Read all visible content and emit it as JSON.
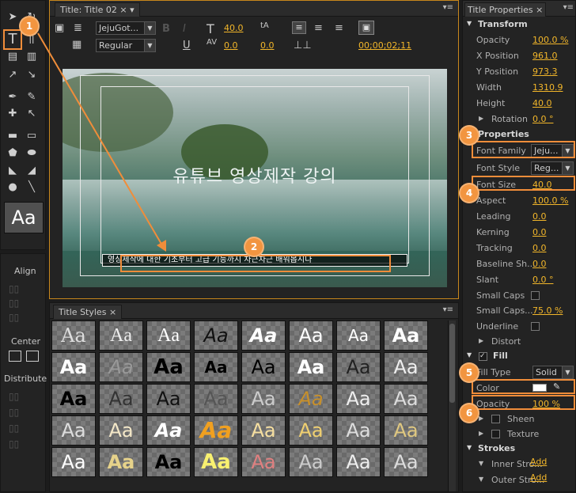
{
  "tools": {
    "aa_preview": "Aa",
    "align_label": "Align",
    "center_label": "Center",
    "distribute_label": "Distribute"
  },
  "title_panel": {
    "tab_label": "Title: Title 02",
    "font_family": "JejuGot...",
    "font_style": "Regular",
    "font_size": "40.0",
    "kerning": "0.0",
    "leading": "0.0",
    "timecode": "00;00;02;11",
    "title_text": "유튜브 영상제작 강의",
    "subtitle_text": "영상제작에 대한 기초부터 고급 기능까지 차근차근 배워봅시다"
  },
  "styles_panel": {
    "tab_label": "Title Styles",
    "swatch_label": "Aa"
  },
  "properties": {
    "tab_label": "Title Properties",
    "transform_header": "Transform",
    "opacity_label": "Opacity",
    "opacity_value": "100.0 %",
    "xpos_label": "X Position",
    "xpos_value": "961.0",
    "ypos_label": "Y Position",
    "ypos_value": "973.3",
    "width_label": "Width",
    "width_value": "1310.9",
    "height_label": "Height",
    "height_value": "40.0",
    "rotation_label": "Rotation",
    "rotation_value": "0.0 °",
    "properties_header": "Properties",
    "font_family_label": "Font Family",
    "font_family_value": "Jeju...",
    "font_style_label": "Font Style",
    "font_style_value": "Reg...",
    "font_size_label": "Font Size",
    "font_size_value": "40.0",
    "aspect_label": "Aspect",
    "aspect_value": "100.0 %",
    "leading_label": "Leading",
    "leading_value": "0.0",
    "kerning_label": "Kerning",
    "kerning_value": "0.0",
    "tracking_label": "Tracking",
    "tracking_value": "0.0",
    "baseline_label": "Baseline Sh...",
    "baseline_value": "0.0",
    "slant_label": "Slant",
    "slant_value": "0.0 °",
    "smallcaps_label": "Small Caps",
    "smallcaps_size_label": "Small Caps...",
    "smallcaps_size_value": "75.0 %",
    "underline_label": "Underline",
    "distort_label": "Distort",
    "fill_header": "Fill",
    "fill_type_label": "Fill Type",
    "fill_type_value": "Solid",
    "color_label": "Color",
    "fill_color": "#ffffff",
    "fill_opacity_label": "Opacity",
    "fill_opacity_value": "100 %",
    "sheen_label": "Sheen",
    "texture_label": "Texture",
    "strokes_header": "Strokes",
    "inner_stroke_label": "Inner Stro...",
    "outer_stroke_label": "Outer Stro...",
    "add_label": "Add"
  },
  "badges": [
    "1",
    "2",
    "3",
    "4",
    "5",
    "6"
  ],
  "colors": {
    "accent": "#f2b62a",
    "highlight": "#f08d3a",
    "badge": "#f29540"
  }
}
